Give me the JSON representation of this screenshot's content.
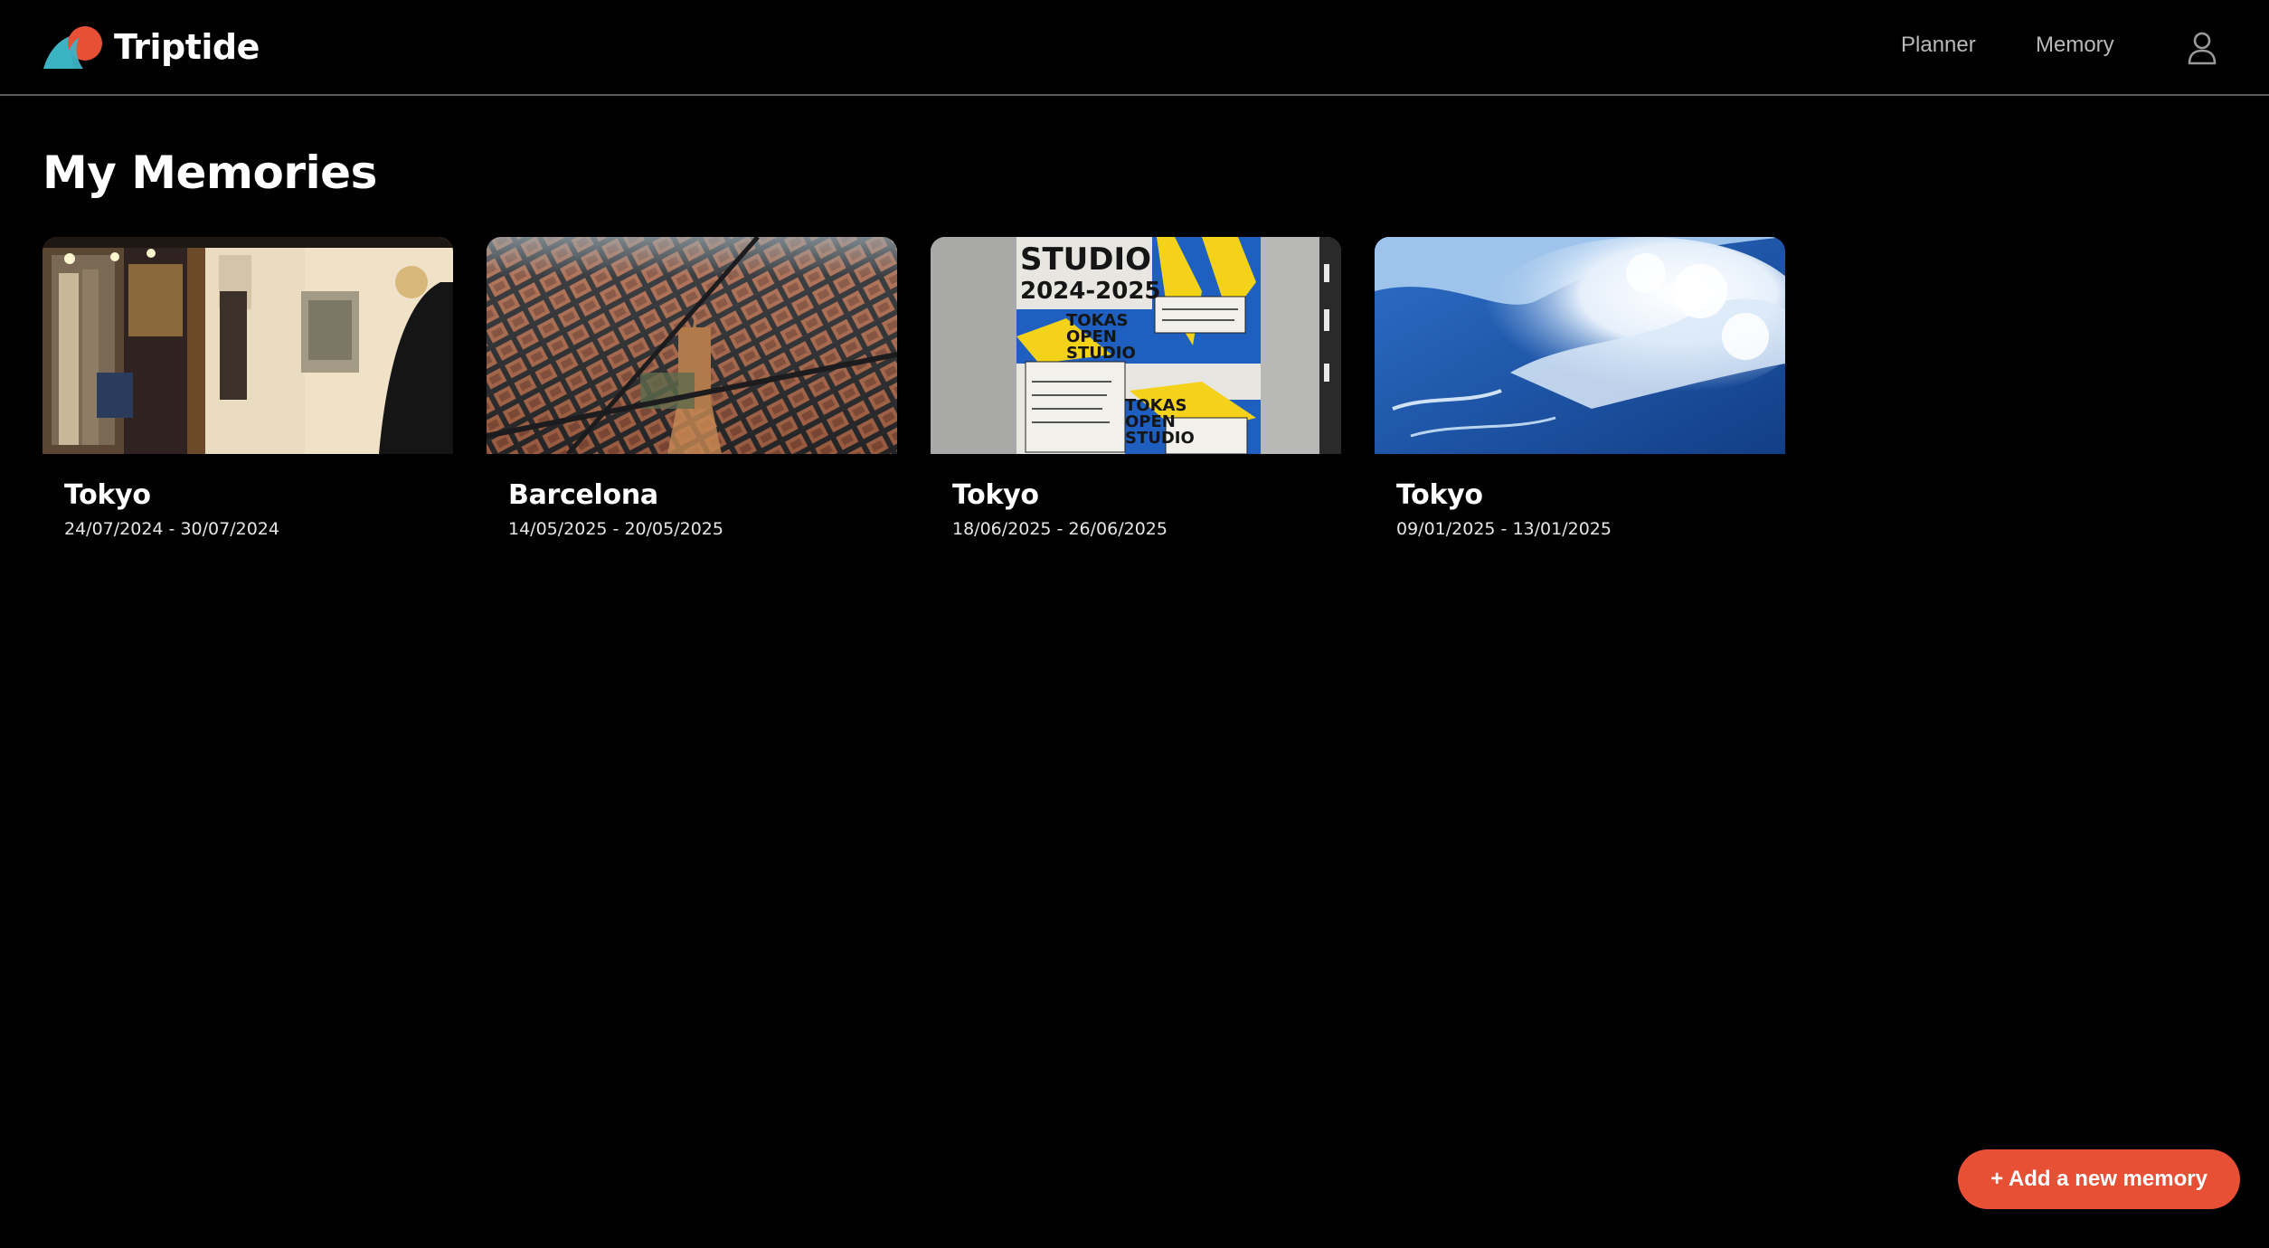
{
  "header": {
    "app_name": "Triptide",
    "logo_icon": "wave-sun-logo",
    "nav": {
      "planner_label": "Planner",
      "memory_label": "Memory"
    },
    "profile_icon": "user-icon"
  },
  "main": {
    "title": "My Memories",
    "memories": [
      {
        "city": "Tokyo",
        "dates": "24/07/2024 - 30/07/2024",
        "image": "vintage-shop-photo"
      },
      {
        "city": "Barcelona",
        "dates": "14/05/2025 - 20/05/2025",
        "image": "aerial-city-photo"
      },
      {
        "city": "Tokyo",
        "dates": "18/06/2025 - 26/06/2025",
        "image": "studio-poster-photo"
      },
      {
        "city": "Tokyo",
        "dates": "09/01/2025 - 13/01/2025",
        "image": "ocean-wave-photo"
      }
    ],
    "poster_text": {
      "line1": "STUDIO",
      "line2": "2024-2025",
      "block1a": "TOKAS",
      "block1b": "OPEN",
      "block1c": "STUDIO",
      "block2a": "TOKAS",
      "block2b": "OPEN",
      "block2c": "STUDIO"
    }
  },
  "actions": {
    "add_label": "+ Add a new memory"
  },
  "colors": {
    "background": "#000000",
    "accent": "#e85035",
    "logo_teal": "#3bb3c3",
    "nav_text": "#b8b8b8"
  }
}
